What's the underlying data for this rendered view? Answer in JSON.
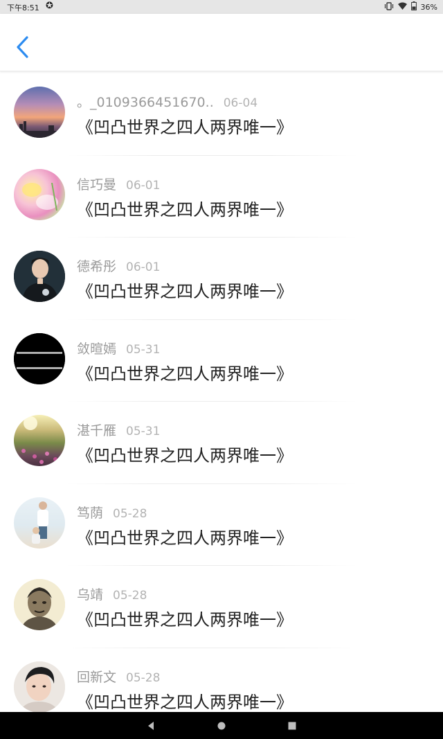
{
  "status_bar": {
    "time": "下午8:51",
    "battery": "36%"
  },
  "header": {
    "back_icon": "chevron-left-icon",
    "accent_color": "#2d8cf0"
  },
  "comments": [
    {
      "name": "。_0109366451670..",
      "date": "06-04",
      "text": "《凹凸世界之四人两界唯一》",
      "avatar": "sunset-sky"
    },
    {
      "name": "信巧曼",
      "date": "06-01",
      "text": "《凹凸世界之四人两界唯一》",
      "avatar": "pink-flowers"
    },
    {
      "name": "德希彤",
      "date": "06-01",
      "text": "《凹凸世界之四人两界唯一》",
      "avatar": "young-man-jersey"
    },
    {
      "name": "敛暄嫣",
      "date": "05-31",
      "text": "《凹凸世界之四人两界唯一》",
      "avatar": "black-text-image"
    },
    {
      "name": "湛千雁",
      "date": "05-31",
      "text": "《凹凸世界之四人两界唯一》",
      "avatar": "flower-field"
    },
    {
      "name": "笃荫",
      "date": "05-28",
      "text": "《凹凸世界之四人两界唯一》",
      "avatar": "father-child-beach"
    },
    {
      "name": "乌靖",
      "date": "05-28",
      "text": "《凹凸世界之四人两界唯一》",
      "avatar": "sketch-portrait"
    },
    {
      "name": "回新文",
      "date": "05-28",
      "text": "《凹凸世界之四人两界唯一》",
      "avatar": "young-man-selfie"
    }
  ]
}
